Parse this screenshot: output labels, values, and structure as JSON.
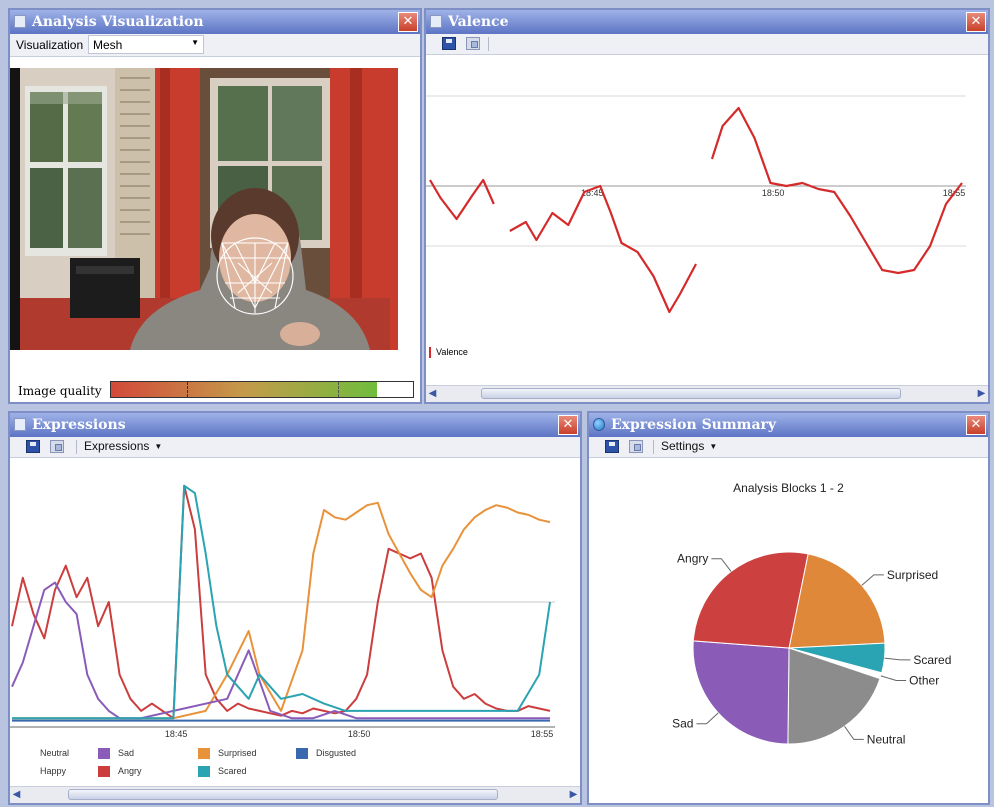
{
  "analysis_panel": {
    "title": "Analysis Visualization",
    "visualization_label": "Visualization",
    "visualization_value": "Mesh",
    "image_quality_label": "Image quality",
    "image_quality_level": 0.88
  },
  "valence_panel": {
    "title": "Valence",
    "legend_label": "Valence",
    "line_color": "#d42a2a"
  },
  "expressions_panel": {
    "title": "Expressions",
    "dropdown_label": "Expressions",
    "legend": [
      {
        "label": "Neutral",
        "color": ""
      },
      {
        "label": "Sad",
        "color": "#8a5cb8"
      },
      {
        "label": "Surprised",
        "color": "#e8923a"
      },
      {
        "label": "Disgusted",
        "color": "#3a68b0"
      },
      {
        "label": "Happy",
        "color": ""
      },
      {
        "label": "Angry",
        "color": "#cc3d3d"
      },
      {
        "label": "Scared",
        "color": "#2aa3b2"
      }
    ]
  },
  "summary_panel": {
    "title": "Expression Summary",
    "dropdown_label": "Settings"
  },
  "colors": {
    "title_bar": "#6a82cc",
    "close_button": "#d9503a",
    "valence_line": "#d42a2a"
  },
  "chart_data": [
    {
      "type": "line",
      "chart": "valence",
      "x_ticks": [
        "18:45",
        "18:50",
        "18:55"
      ],
      "series": [
        {
          "name": "Valence",
          "x": [
            0.0,
            0.02,
            0.05,
            0.08,
            0.1,
            0.12,
            0.15,
            0.18,
            0.2,
            0.23,
            0.26,
            0.29,
            0.32,
            0.34,
            0.36,
            0.39,
            0.42,
            0.45,
            0.47,
            0.5,
            0.53,
            0.55,
            0.58,
            0.61,
            0.64,
            0.67,
            0.7,
            0.73,
            0.76,
            0.79,
            0.82,
            0.85,
            0.88,
            0.91,
            0.94,
            0.97,
            1.0
          ],
          "values": [
            0.1,
            -0.2,
            -0.55,
            -0.15,
            0.1,
            -0.3,
            -0.75,
            -0.6,
            -0.9,
            -0.45,
            -0.65,
            -0.1,
            0.0,
            -0.45,
            -0.95,
            -1.1,
            -1.5,
            -2.1,
            -1.8,
            -1.3,
            0.45,
            1.0,
            1.3,
            0.8,
            0.05,
            0.0,
            0.05,
            -0.05,
            -0.1,
            -0.5,
            -0.95,
            -1.4,
            -1.45,
            -1.4,
            -1.0,
            -0.3,
            0.05
          ]
        }
      ]
    },
    {
      "type": "line",
      "chart": "expressions",
      "x_ticks": [
        "18:45",
        "18:50",
        "18:55"
      ],
      "series": [
        {
          "name": "Angry",
          "x": [
            0.0,
            0.02,
            0.04,
            0.06,
            0.08,
            0.1,
            0.12,
            0.14,
            0.16,
            0.18,
            0.2,
            0.22,
            0.24,
            0.26,
            0.28,
            0.3,
            0.32,
            0.34,
            0.36,
            0.38,
            0.4,
            0.42,
            0.44,
            0.46,
            0.48,
            0.5,
            0.52,
            0.54,
            0.56,
            0.58,
            0.6,
            0.62,
            0.64,
            0.66,
            0.68,
            0.7,
            0.72,
            0.74,
            0.76,
            0.78,
            0.8,
            0.82,
            0.84,
            0.86,
            0.88,
            0.9,
            0.92,
            0.94,
            0.96,
            0.98,
            1.0
          ],
          "values": [
            0.4,
            0.6,
            0.45,
            0.35,
            0.55,
            0.65,
            0.52,
            0.6,
            0.4,
            0.5,
            0.2,
            0.1,
            0.05,
            0.08,
            0.05,
            0.02,
            0.98,
            0.8,
            0.2,
            0.1,
            0.05,
            0.08,
            0.06,
            0.05,
            0.04,
            0.03,
            0.05,
            0.04,
            0.06,
            0.05,
            0.04,
            0.05,
            0.1,
            0.2,
            0.5,
            0.72,
            0.7,
            0.68,
            0.7,
            0.6,
            0.3,
            0.15,
            0.1,
            0.12,
            0.08,
            0.06,
            0.05,
            0.05,
            0.07,
            0.06,
            0.05
          ]
        },
        {
          "name": "Surprised",
          "x": [
            0.0,
            0.1,
            0.2,
            0.3,
            0.36,
            0.4,
            0.44,
            0.46,
            0.5,
            0.54,
            0.56,
            0.58,
            0.6,
            0.62,
            0.64,
            0.66,
            0.68,
            0.7,
            0.72,
            0.74,
            0.76,
            0.78,
            0.8,
            0.82,
            0.84,
            0.86,
            0.88,
            0.9,
            0.92,
            0.94,
            0.96,
            0.98,
            1.0
          ],
          "values": [
            0.02,
            0.02,
            0.02,
            0.02,
            0.05,
            0.2,
            0.38,
            0.2,
            0.05,
            0.3,
            0.7,
            0.88,
            0.85,
            0.84,
            0.87,
            0.9,
            0.91,
            0.78,
            0.7,
            0.62,
            0.55,
            0.52,
            0.65,
            0.72,
            0.8,
            0.85,
            0.88,
            0.9,
            0.89,
            0.87,
            0.86,
            0.84,
            0.83
          ]
        },
        {
          "name": "Sad",
          "x": [
            0.0,
            0.02,
            0.04,
            0.06,
            0.08,
            0.1,
            0.12,
            0.14,
            0.16,
            0.18,
            0.2,
            0.22,
            0.24,
            0.3,
            0.4,
            0.44,
            0.48,
            0.52,
            0.56,
            0.6,
            0.64,
            0.68,
            0.72,
            0.76,
            0.8,
            0.84,
            0.88,
            0.92,
            0.96,
            1.0
          ],
          "values": [
            0.15,
            0.25,
            0.4,
            0.55,
            0.58,
            0.5,
            0.45,
            0.2,
            0.1,
            0.05,
            0.02,
            0.02,
            0.02,
            0.05,
            0.1,
            0.3,
            0.05,
            0.02,
            0.02,
            0.05,
            0.02,
            0.02,
            0.02,
            0.02,
            0.02,
            0.02,
            0.02,
            0.02,
            0.02,
            0.02
          ]
        },
        {
          "name": "Scared",
          "x": [
            0.0,
            0.1,
            0.2,
            0.3,
            0.32,
            0.34,
            0.36,
            0.38,
            0.4,
            0.42,
            0.44,
            0.46,
            0.5,
            0.54,
            0.58,
            0.62,
            0.66,
            0.7,
            0.74,
            0.78,
            0.82,
            0.86,
            0.9,
            0.94,
            0.98,
            1.0
          ],
          "values": [
            0.02,
            0.02,
            0.02,
            0.02,
            0.98,
            0.95,
            0.7,
            0.4,
            0.2,
            0.15,
            0.1,
            0.2,
            0.1,
            0.12,
            0.08,
            0.05,
            0.05,
            0.05,
            0.05,
            0.05,
            0.05,
            0.05,
            0.05,
            0.05,
            0.2,
            0.5
          ]
        },
        {
          "name": "Disgusted",
          "x": [
            0.0,
            0.2,
            0.4,
            0.6,
            0.8,
            1.0
          ],
          "values": [
            0.01,
            0.01,
            0.01,
            0.01,
            0.01,
            0.01
          ]
        }
      ]
    },
    {
      "type": "pie",
      "chart": "expression_summary",
      "title": "Analysis Blocks 1 - 2",
      "labels": [
        "Surprised",
        "Scared",
        "Other",
        "Neutral",
        "Sad",
        "Angry"
      ],
      "values": [
        21,
        5,
        1,
        20,
        26,
        27
      ],
      "colors": [
        "#e0883a",
        "#2aa3b2",
        "#ffffff",
        "#8c8c8c",
        "#8a5cb8",
        "#cc4040"
      ]
    }
  ]
}
